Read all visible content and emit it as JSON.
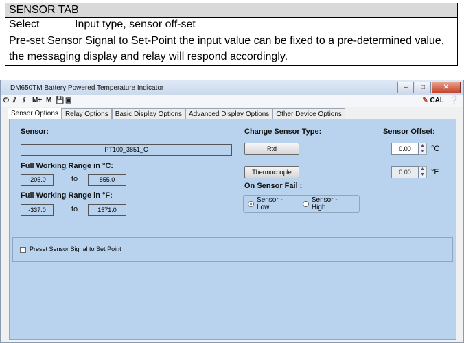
{
  "doc": {
    "heading": "SENSOR TAB",
    "select_label": "Select",
    "select_value": "Input type, sensor off-set",
    "description": "Pre-set Sensor Signal to Set-Point the input value can be fixed to a pre-determined value, the messaging display and relay will respond accordingly."
  },
  "window": {
    "title": "DM650TM Battery Powered Temperature Indicator",
    "minimize_icon": "minimize-icon",
    "maximize_icon": "maximize-icon",
    "close_icon": "close-icon"
  },
  "toolbar": {
    "memory_plus": "M+",
    "memory": "M",
    "cal": "CAL"
  },
  "tabs": [
    {
      "label": "Sensor Options",
      "active": true
    },
    {
      "label": "Relay Options",
      "active": false
    },
    {
      "label": "Basic Display Options",
      "active": false
    },
    {
      "label": "Advanced Display Options",
      "active": false
    },
    {
      "label": "Other Device Options",
      "active": false
    }
  ],
  "sensor": {
    "label": "Sensor:",
    "value": "PT100_3851_C",
    "range_c_label": "Full Working Range in °C:",
    "range_c_min": "-205.0",
    "range_c_max": "855.0",
    "range_f_label": "Full Working Range in °F:",
    "range_f_min": "-337.0",
    "range_f_max": "1571.0",
    "to": "to"
  },
  "change_type": {
    "label": "Change Sensor Type:",
    "rtd": "Rtd",
    "thermocouple": "Thermocouple",
    "fail_label": "On Sensor Fail :",
    "fail_low": "Sensor - Low",
    "fail_high": "Sensor - High",
    "fail_selected": "Sensor - Low"
  },
  "offset": {
    "label": "Sensor Offset:",
    "c_value": "0.00",
    "c_unit": "°C",
    "f_value": "0.00",
    "f_unit": "°F"
  },
  "preset": {
    "label": "Preset Sensor Signal to Set Point",
    "checked": false
  }
}
